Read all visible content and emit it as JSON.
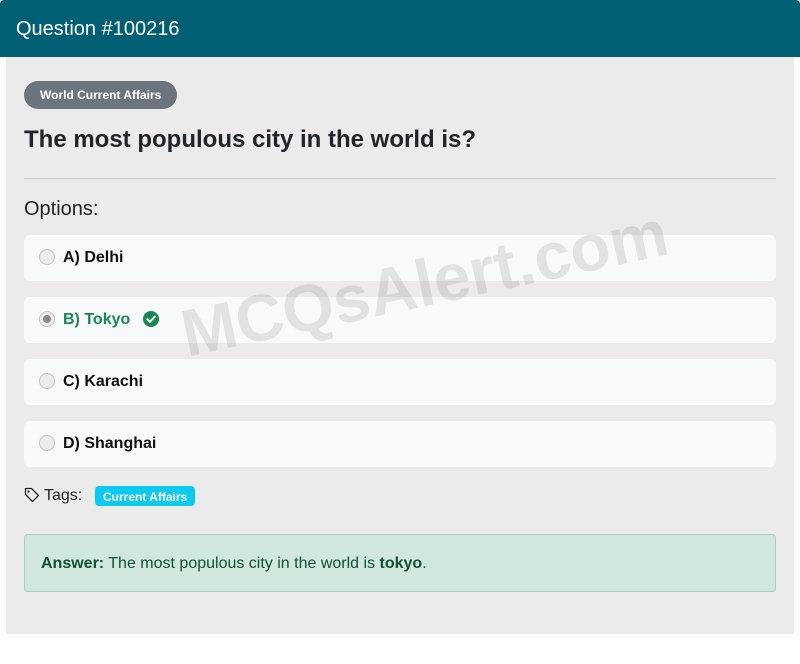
{
  "header": {
    "title": "Question #100216"
  },
  "question": {
    "category": "World Current Affairs",
    "text": "The most populous city in the world is?"
  },
  "options": {
    "label": "Options:",
    "items": [
      {
        "label": "A) Delhi",
        "selected": false,
        "correct": false
      },
      {
        "label": "B) Tokyo",
        "selected": true,
        "correct": true
      },
      {
        "label": "C) Karachi",
        "selected": false,
        "correct": false
      },
      {
        "label": "D) Shanghai",
        "selected": false,
        "correct": false
      }
    ]
  },
  "watermark": "MCQsAlert.com",
  "tags": {
    "label": "Tags:",
    "items": [
      "Current Affairs"
    ],
    "icon": "tag-icon"
  },
  "answer": {
    "prefix": "Answer:",
    "text": " The most populous city in the world is ",
    "value": "tokyo",
    "suffix": "."
  },
  "colors": {
    "header": "#005f73",
    "correct": "#198754",
    "badge": "#6c757d",
    "tag": "#0dcaf0",
    "answer_bg": "#d1e7dd"
  }
}
